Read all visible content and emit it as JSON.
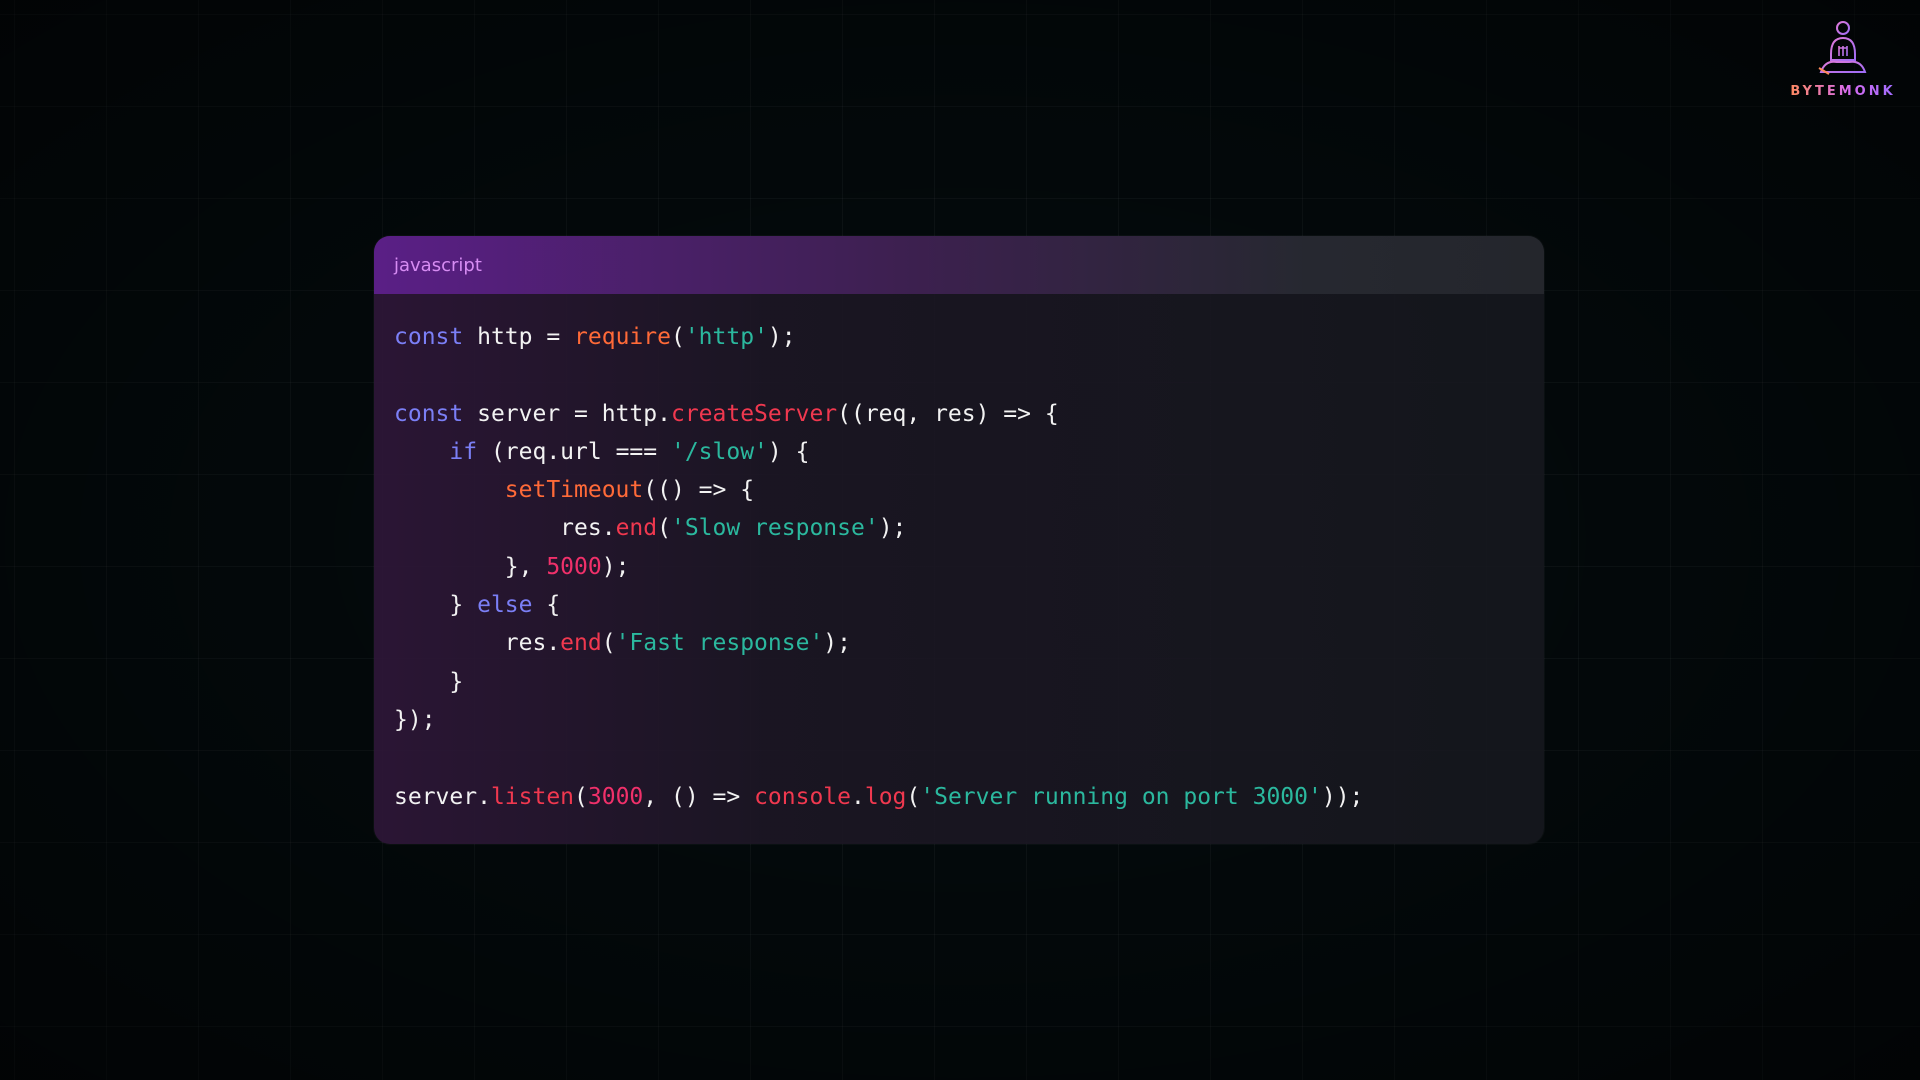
{
  "logo": {
    "text": "BYTEMONK"
  },
  "code_window": {
    "language": "javascript",
    "lines": [
      [
        {
          "t": "const",
          "c": "kw"
        },
        {
          "t": " http = ",
          "c": "pl"
        },
        {
          "t": "require",
          "c": "fn-orange"
        },
        {
          "t": "(",
          "c": "pl"
        },
        {
          "t": "'http'",
          "c": "str"
        },
        {
          "t": ");",
          "c": "pl"
        }
      ],
      [],
      [
        {
          "t": "const",
          "c": "kw"
        },
        {
          "t": " server = http.",
          "c": "pl"
        },
        {
          "t": "createServer",
          "c": "fn"
        },
        {
          "t": "((req, res) => {",
          "c": "pl"
        }
      ],
      [
        {
          "t": "    ",
          "c": "pl"
        },
        {
          "t": "if",
          "c": "kw"
        },
        {
          "t": " (req.url === ",
          "c": "pl"
        },
        {
          "t": "'/slow'",
          "c": "str"
        },
        {
          "t": ") {",
          "c": "pl"
        }
      ],
      [
        {
          "t": "        ",
          "c": "pl"
        },
        {
          "t": "setTimeout",
          "c": "fn-orange"
        },
        {
          "t": "(() => {",
          "c": "pl"
        }
      ],
      [
        {
          "t": "            res.",
          "c": "pl"
        },
        {
          "t": "end",
          "c": "fn"
        },
        {
          "t": "(",
          "c": "pl"
        },
        {
          "t": "'Slow response'",
          "c": "str"
        },
        {
          "t": ");",
          "c": "pl"
        }
      ],
      [
        {
          "t": "        }, ",
          "c": "pl"
        },
        {
          "t": "5000",
          "c": "num"
        },
        {
          "t": ");",
          "c": "pl"
        }
      ],
      [
        {
          "t": "    } ",
          "c": "pl"
        },
        {
          "t": "else",
          "c": "kw"
        },
        {
          "t": " {",
          "c": "pl"
        }
      ],
      [
        {
          "t": "        res.",
          "c": "pl"
        },
        {
          "t": "end",
          "c": "fn"
        },
        {
          "t": "(",
          "c": "pl"
        },
        {
          "t": "'Fast response'",
          "c": "str"
        },
        {
          "t": ");",
          "c": "pl"
        }
      ],
      [
        {
          "t": "    }",
          "c": "pl"
        }
      ],
      [
        {
          "t": "});",
          "c": "pl"
        }
      ],
      [],
      [
        {
          "t": "server.",
          "c": "pl"
        },
        {
          "t": "listen",
          "c": "fn"
        },
        {
          "t": "(",
          "c": "pl"
        },
        {
          "t": "3000",
          "c": "num"
        },
        {
          "t": ", () => ",
          "c": "pl"
        },
        {
          "t": "console",
          "c": "fn"
        },
        {
          "t": ".",
          "c": "pl"
        },
        {
          "t": "log",
          "c": "fn"
        },
        {
          "t": "(",
          "c": "pl"
        },
        {
          "t": "'Server running on port 3000'",
          "c": "str"
        },
        {
          "t": "));",
          "c": "pl"
        }
      ]
    ]
  },
  "colors": {
    "background": "#03090b",
    "keyword": "#7b7ff6",
    "function": "#f0384f",
    "function_alt": "#ff6a38",
    "string": "#2bb89e",
    "number": "#f0306a",
    "plain": "#f2f2f2",
    "language_label": "#d78cf3",
    "header_accent": "#5a1f86"
  },
  "icons": {
    "logo": "monk-meditating-icon"
  }
}
